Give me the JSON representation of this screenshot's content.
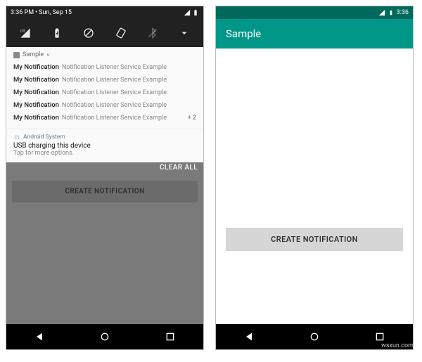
{
  "left": {
    "status": {
      "time": "3:36 PM",
      "sep": "•",
      "date": "Sun, Sep 15"
    },
    "qs_icons": [
      "signal-lte-icon",
      "battery-charging-icon",
      "dnd-off-icon",
      "autorotate-icon",
      "bluetooth-off-icon",
      "chevron-down-icon"
    ],
    "notif_app": {
      "name": "Sample",
      "chevron": "˅"
    },
    "notifications": [
      {
        "title": "My Notification",
        "text": "Notification Listener Service Example",
        "extra": ""
      },
      {
        "title": "My Notification",
        "text": "Notification Listener Service Example",
        "extra": ""
      },
      {
        "title": "My Notification",
        "text": "Notification Listener Service Example",
        "extra": ""
      },
      {
        "title": "My Notification",
        "text": "Notification Listener Service Example",
        "extra": ""
      },
      {
        "title": "My Notification",
        "text": "Notification Listener Service Example",
        "extra": "+ 2"
      }
    ],
    "system_notif": {
      "source": "Android System",
      "title": "USB charging this device",
      "subtitle": "Tap for more options."
    },
    "clear_all": "CLEAR ALL",
    "button_label": "CREATE NOTIFICATION"
  },
  "right": {
    "status_time": "3:36",
    "appbar_title": "Sample",
    "button_label": "CREATE NOTIFICATION"
  },
  "watermark": "wsxun.com"
}
